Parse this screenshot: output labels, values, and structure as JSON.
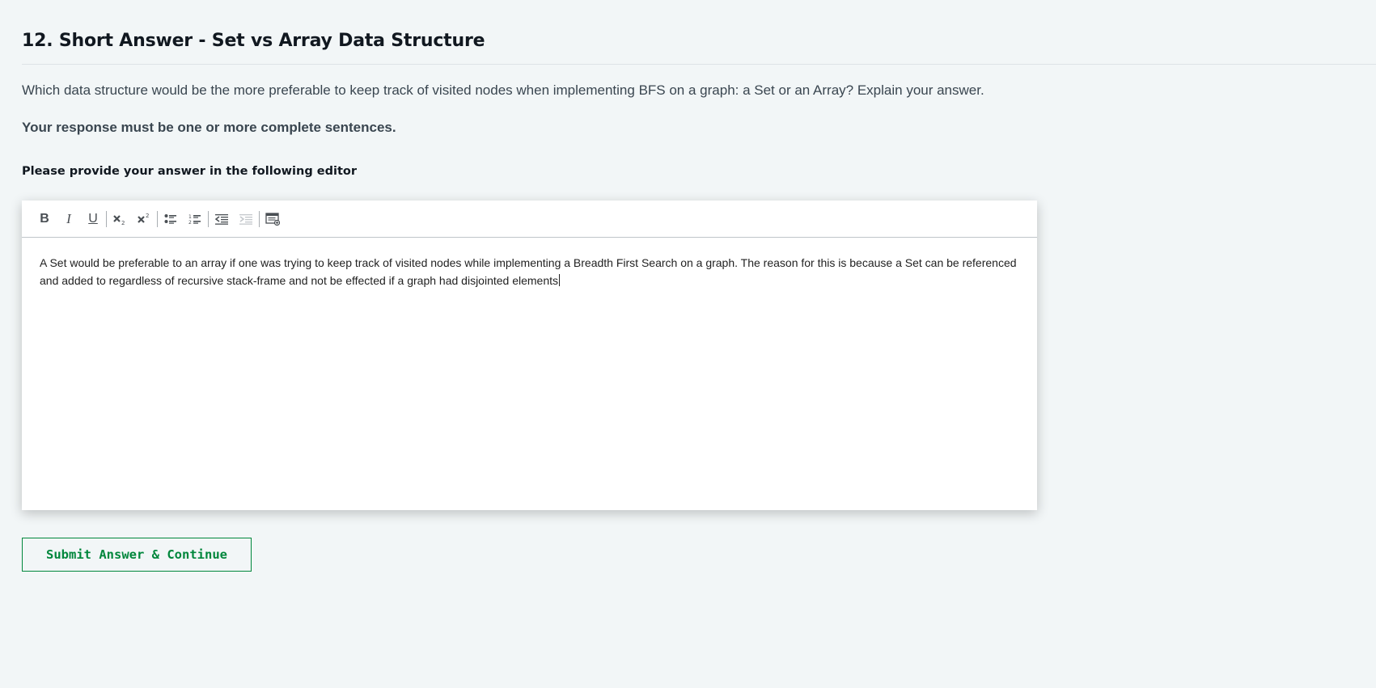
{
  "question": {
    "title": "12. Short Answer - Set vs Array Data Structure",
    "text": "Which data structure would be the more preferable to keep track of visited nodes when implementing BFS on a graph: a Set or an Array? Explain your answer.",
    "requirement": "Your response must be one or more complete sentences.",
    "instruction": "Please provide your answer in the following editor"
  },
  "editor": {
    "toolbar": [
      {
        "name": "bold-button",
        "icon": "bold-icon",
        "label": "B"
      },
      {
        "name": "italic-button",
        "icon": "italic-icon",
        "label": "I"
      },
      {
        "name": "underline-button",
        "icon": "underline-icon",
        "label": "U"
      },
      {
        "name": "subscript-button",
        "icon": "subscript-icon"
      },
      {
        "name": "superscript-button",
        "icon": "superscript-icon"
      },
      {
        "name": "bulleted-list-button",
        "icon": "bulleted-list-icon"
      },
      {
        "name": "numbered-list-button",
        "icon": "numbered-list-icon"
      },
      {
        "name": "decrease-indent-button",
        "icon": "decrease-indent-icon"
      },
      {
        "name": "increase-indent-button",
        "icon": "increase-indent-icon",
        "disabled": true
      },
      {
        "name": "insert-template-button",
        "icon": "insert-template-icon"
      }
    ],
    "answer": "A Set would be preferable to an array if one was trying to keep track of visited nodes while implementing a Breadth First Search on a graph. The reason for this is because a Set can be referenced and added to regardless of recursive stack-frame and not be effected if a graph had disjointed elements"
  },
  "submit_label": "Submit Answer & Continue",
  "colors": {
    "background": "#f2f6f7",
    "accent_green": "#00873c",
    "heading": "#111820",
    "text": "#3a4650"
  }
}
